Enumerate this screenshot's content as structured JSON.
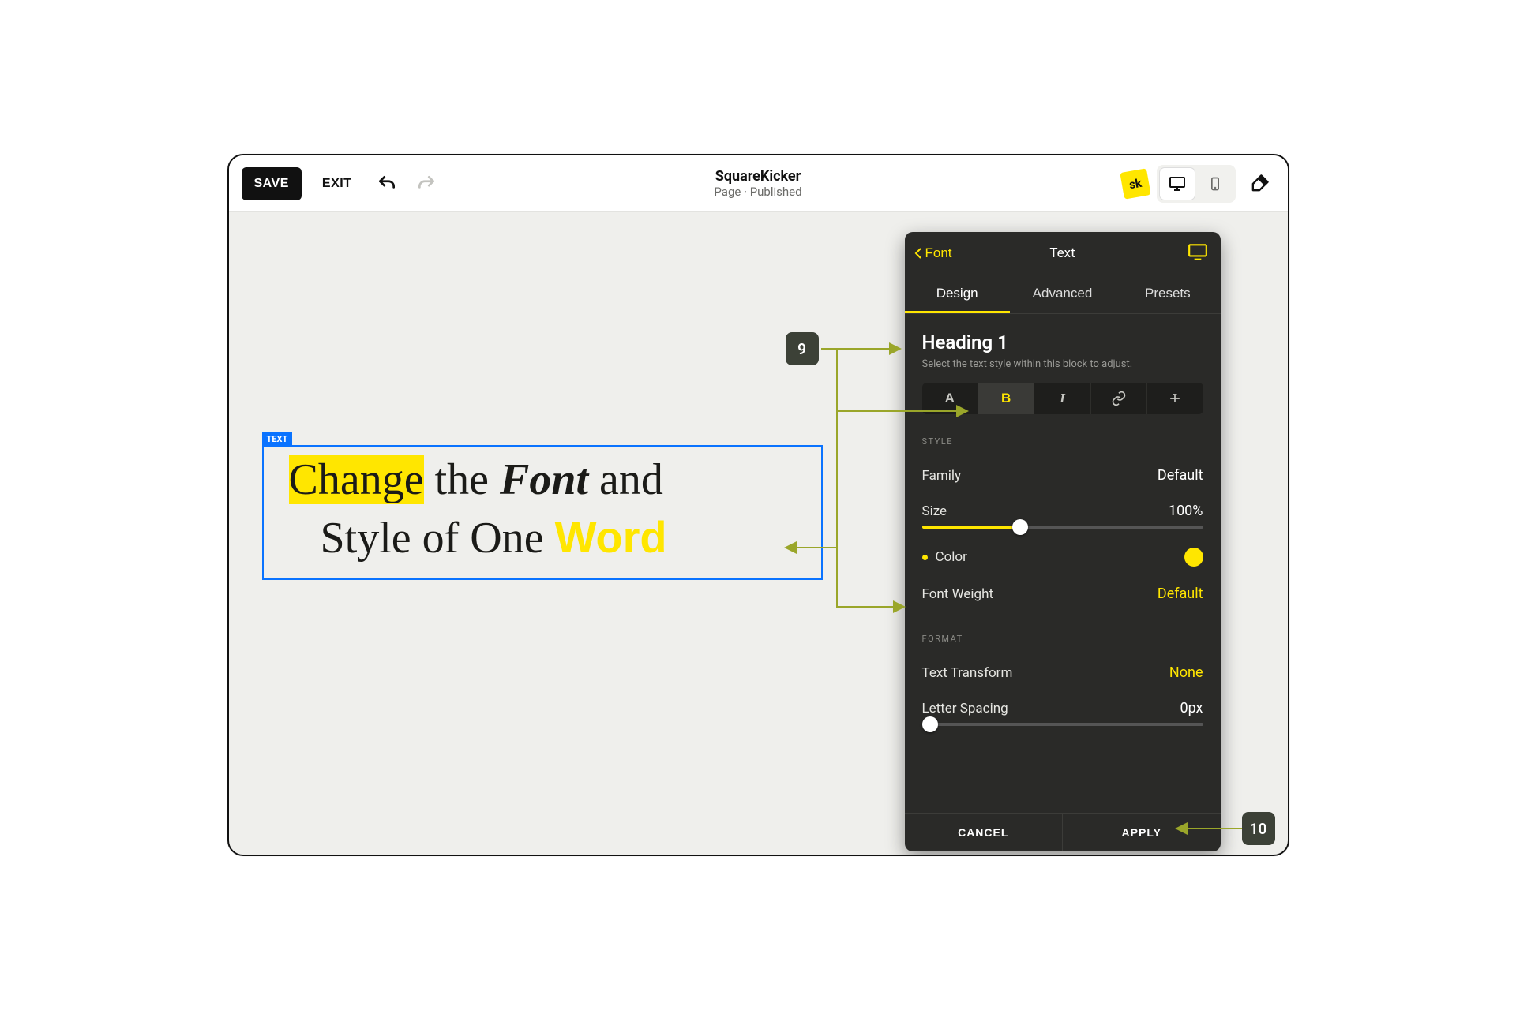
{
  "topbar": {
    "save": "SAVE",
    "exit": "EXIT",
    "title": "SquareKicker",
    "subtitle": "Page · Published",
    "logo_text": "sk"
  },
  "text_block": {
    "tag": "TEXT",
    "word_change": "Change",
    "word_the": " the ",
    "word_font": "Font",
    "word_and": " and",
    "line2_prefix": "Style of One ",
    "word_word": "Word"
  },
  "panel": {
    "back_label": "Font",
    "title": "Text",
    "tabs": {
      "design": "Design",
      "advanced": "Advanced",
      "presets": "Presets"
    },
    "heading": "Heading 1",
    "heading_sub": "Select the text style within this block to adjust.",
    "segments": {
      "normal": "A",
      "bold": "B",
      "italic": "I"
    },
    "style_section": "STYLE",
    "family_label": "Family",
    "family_value": "Default",
    "size_label": "Size",
    "size_value": "100%",
    "size_fill_pct": 35,
    "color_label": "Color",
    "color_value": "#ffe600",
    "weight_label": "Font Weight",
    "weight_value": "Default",
    "format_section": "FORMAT",
    "transform_label": "Text Transform",
    "transform_value": "None",
    "spacing_label": "Letter Spacing",
    "spacing_value": "0px",
    "spacing_fill_pct": 0,
    "cancel": "CANCEL",
    "apply": "APPLY"
  },
  "callouts": {
    "nine": "9",
    "ten": "10"
  }
}
